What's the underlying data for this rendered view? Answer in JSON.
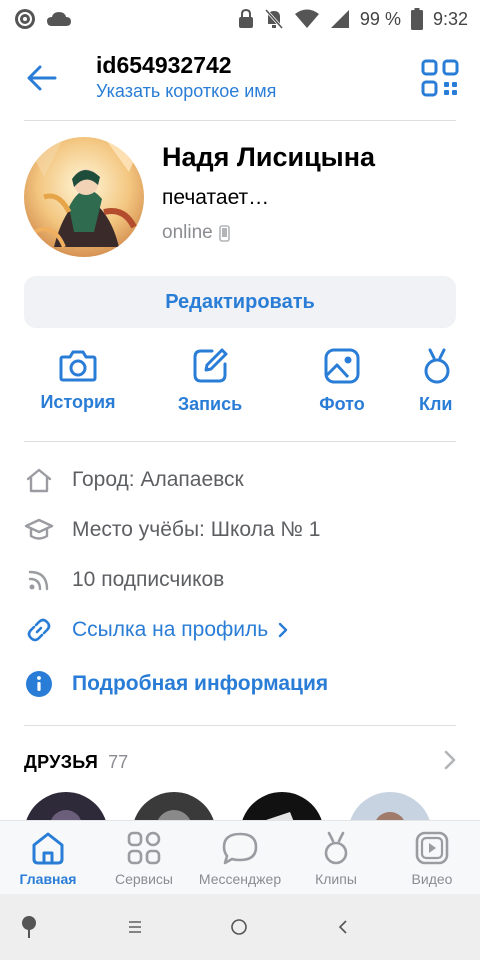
{
  "status_bar": {
    "battery": "99 %",
    "time": "9:32",
    "icons": [
      "app-icon",
      "cloud-icon",
      "lock-icon",
      "bell-off-icon",
      "wifi-icon",
      "signal-icon",
      "battery-icon"
    ]
  },
  "header": {
    "title": "id654932742",
    "subtitle": "Указать короткое имя"
  },
  "profile": {
    "name": "Надя Лисицына",
    "typing": "печатает…",
    "online": "online",
    "edit_label": "Редактировать"
  },
  "actions": [
    {
      "label": "История",
      "icon": "camera-icon"
    },
    {
      "label": "Запись",
      "icon": "edit-icon"
    },
    {
      "label": "Фото",
      "icon": "image-icon"
    },
    {
      "label": "Кли",
      "icon": "clips-icon"
    }
  ],
  "info": {
    "city": "Город: Алапаевск",
    "school": "Место учёбы: Школа № 1",
    "followers": "10 подписчиков",
    "link": "Ссылка на профиль",
    "details": "Подробная информация"
  },
  "friends": {
    "title": "ДРУЗЬЯ",
    "count": "77"
  },
  "tabs": [
    {
      "label": "Главная",
      "icon": "home-icon",
      "active": true
    },
    {
      "label": "Сервисы",
      "icon": "services-icon",
      "active": false
    },
    {
      "label": "Мессенджер",
      "icon": "messenger-icon",
      "active": false
    },
    {
      "label": "Клипы",
      "icon": "clips-icon",
      "active": false
    },
    {
      "label": "Видео",
      "icon": "video-icon",
      "active": false
    }
  ],
  "colors": {
    "accent": "#2a7dd6",
    "secondary_text": "#8a8c91",
    "button_bg": "#f0f2f5"
  }
}
